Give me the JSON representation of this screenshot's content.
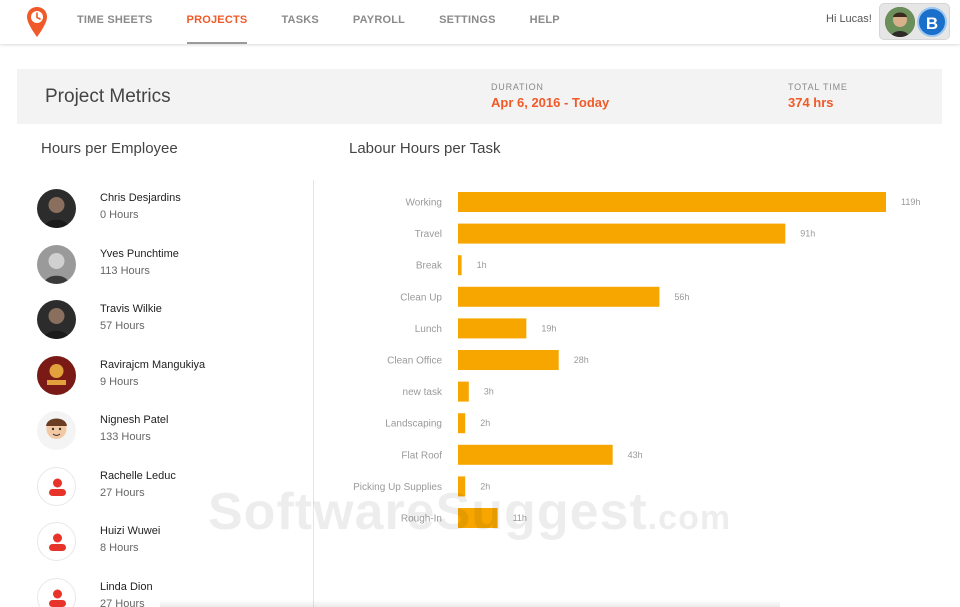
{
  "nav": {
    "items": [
      "TIME SHEETS",
      "PROJECTS",
      "TASKS",
      "PAYROLL",
      "SETTINGS",
      "HELP"
    ],
    "active": "PROJECTS",
    "greeting": "Hi Lucas!",
    "badge_letter": "B"
  },
  "metrics": {
    "title": "Project Metrics",
    "duration_label": "DURATION",
    "duration_value": "Apr 6, 2016 - Today",
    "total_label": "TOTAL TIME",
    "total_value": "374 hrs"
  },
  "employees_title": "Hours per Employee",
  "employees": [
    {
      "name": "Chris Desjardins",
      "hours": "0 Hours",
      "avatar": "photo-dark"
    },
    {
      "name": "Yves Punchtime",
      "hours": "113 Hours",
      "avatar": "photo-bw"
    },
    {
      "name": "Travis Wilkie",
      "hours": "57 Hours",
      "avatar": "photo-dark"
    },
    {
      "name": "Ravirajcm Mangukiya",
      "hours": "9 Hours",
      "avatar": "photo-red"
    },
    {
      "name": "Nignesh Patel",
      "hours": "133 Hours",
      "avatar": "cartoon"
    },
    {
      "name": "Rachelle Leduc",
      "hours": "27 Hours",
      "avatar": "person-placeholder-icon"
    },
    {
      "name": "Huizi Wuwei",
      "hours": "8 Hours",
      "avatar": "person-placeholder-icon"
    },
    {
      "name": "Linda Dion",
      "hours": "27 Hours",
      "avatar": "person-placeholder-icon"
    }
  ],
  "chart_title": "Labour Hours per Task",
  "chart_data": {
    "type": "bar",
    "orientation": "horizontal",
    "title": "Labour Hours per Task",
    "categories": [
      "Working",
      "Travel",
      "Break",
      "Clean Up",
      "Lunch",
      "Clean Office",
      "new task",
      "Landscaping",
      "Flat Roof",
      "Picking Up Supplies",
      "Rough-In"
    ],
    "values": [
      119,
      91,
      1,
      56,
      19,
      28,
      3,
      2,
      43,
      2,
      11
    ],
    "value_labels": [
      "119h",
      "91h",
      "1h",
      "56h",
      "19h",
      "28h",
      "3h",
      "2h",
      "43h",
      "2h",
      "11h"
    ],
    "xlim": [
      0,
      119
    ],
    "color": "#f7a600",
    "grid": false,
    "legend": "none"
  },
  "colors": {
    "accent": "#f05a28",
    "bar": "#f7a600",
    "badge": "#1a6fcb"
  },
  "watermark": {
    "main": "SoftwareSuggest",
    "suffix": ".com"
  }
}
